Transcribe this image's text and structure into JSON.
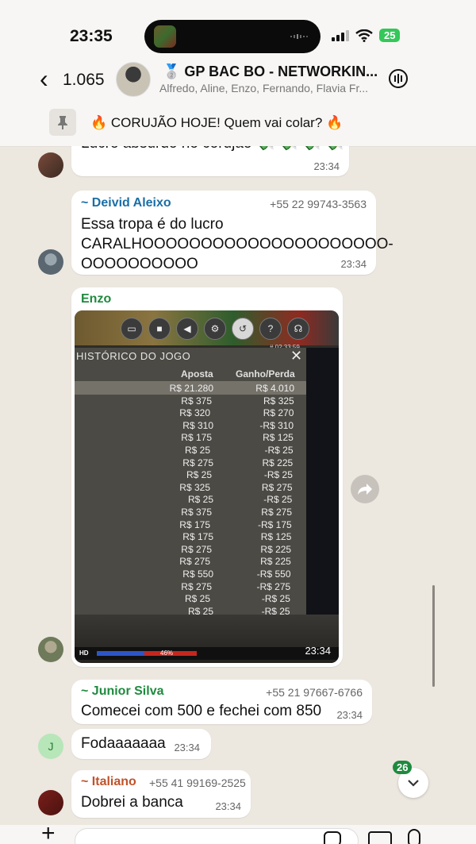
{
  "status": {
    "time": "23:35",
    "battery": "25"
  },
  "header": {
    "back_count": "1.065",
    "title": "🥈 GP BAC BO - NETWORKIN...",
    "subtitle": "Alfredo, Aline, Enzo, Fernando, Flavia Fr..."
  },
  "pinned": {
    "text": "🔥 CORUJÃO HOJE! Quem vai colar? 🔥"
  },
  "messages": [
    {
      "text": "Lucro absurdo no corujão 💸 💸 💸 💸",
      "time": "23:34"
    },
    {
      "sender": "~ Deivid Aleixo",
      "phone": "+55 22 99743-3563",
      "line1": "Essa tropa é do lucro",
      "line2": "CARALHOOOOOOOOOOOOOOOOOOOOO-",
      "line3": "OOOOOOOOOO",
      "time": "23:34"
    },
    {
      "sender": "Enzo",
      "time": "23:34"
    },
    {
      "sender": "~ Junior Silva",
      "phone": "+55 21 97667-6766",
      "text": "Comecei com 500 e fechei com 850",
      "time": "23:34"
    },
    {
      "avatar_letter": "J",
      "text": "Fodaaaaaaa",
      "time": "23:34"
    },
    {
      "sender": "~ Italiano",
      "phone": "+55 41 99169-2525",
      "text": "Dobrei a banca",
      "time": "23:34"
    }
  ],
  "game_image": {
    "title": "HISTÓRICO DO JOGO",
    "col_bet": "Aposta",
    "col_result": "Ganho/Perda",
    "round_id": "# 02:33:59",
    "hud_pct": "46%",
    "rows": [
      {
        "bet": "R$ 21.280",
        "result": "R$ 4.010"
      },
      {
        "bet": "R$ 375",
        "result": "R$ 325"
      },
      {
        "bet": "R$ 320",
        "result": "R$ 270"
      },
      {
        "bet": "R$ 310",
        "result": "-R$ 310"
      },
      {
        "bet": "R$ 175",
        "result": "R$ 125"
      },
      {
        "bet": "R$ 25",
        "result": "-R$ 25"
      },
      {
        "bet": "R$ 275",
        "result": "R$ 225"
      },
      {
        "bet": "R$ 25",
        "result": "-R$ 25"
      },
      {
        "bet": "R$ 325",
        "result": "R$ 275"
      },
      {
        "bet": "R$ 25",
        "result": "-R$ 25"
      },
      {
        "bet": "R$ 375",
        "result": "R$ 275"
      },
      {
        "bet": "R$ 175",
        "result": "-R$ 175"
      },
      {
        "bet": "R$ 175",
        "result": "R$ 125"
      },
      {
        "bet": "R$ 275",
        "result": "R$ 225"
      },
      {
        "bet": "R$ 275",
        "result": "R$ 225"
      },
      {
        "bet": "R$ 550",
        "result": "-R$ 550"
      },
      {
        "bet": "R$ 275",
        "result": "-R$ 275"
      },
      {
        "bet": "R$ 25",
        "result": "-R$ 25"
      },
      {
        "bet": "R$ 25",
        "result": "-R$ 25"
      }
    ]
  },
  "unread_count": "26",
  "colors": {
    "deivid": "#1a6ea6",
    "enzo": "#1f8a3f",
    "junior": "#1f8a3f",
    "italiano": "#c0532a"
  }
}
